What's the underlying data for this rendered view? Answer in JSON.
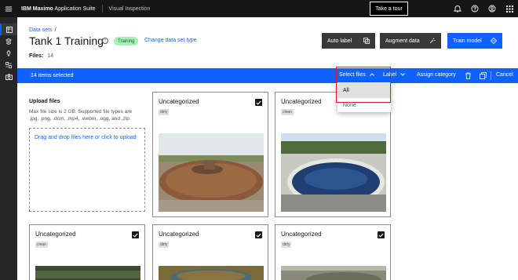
{
  "header": {
    "brand_bold": "IBM Maximo",
    "brand_rest": " Application Suite",
    "product": "Visual Inspection",
    "tour_button": "Take a tour"
  },
  "page": {
    "breadcrumb": "Data sets",
    "breadcrumb_sep": "/",
    "title": "Tank 1 Training",
    "status_tag": "Training",
    "change_link": "Change data set type",
    "files_label": "Files:",
    "files_count": "14",
    "auto_label_button": "Auto label",
    "augment_button": "Augment data",
    "train_button": "Train model"
  },
  "selection_bar": {
    "count_text": "14 items selected",
    "select_files": "Select files",
    "label": "Label",
    "assign_category": "Assign category",
    "cancel": "Cancel"
  },
  "dropdown": {
    "options": [
      "All",
      "None"
    ],
    "selected": "All"
  },
  "upload": {
    "title": "Upload files",
    "description": "Max file size is 2 GB. Supported file types are .jpg, .png, .dcm, .mp4, .webm, .ogg, and .zip.",
    "dropzone_text": "Drag and drop files here or click to upload"
  },
  "cards": [
    {
      "category": "Uncategorized",
      "tag": "dirty",
      "checked": true
    },
    {
      "category": "Uncategorized",
      "tag": "clean",
      "checked": true
    },
    {
      "category": "Uncategorized",
      "tag": "clean",
      "checked": true
    },
    {
      "category": "Uncategorized",
      "tag": "dirty",
      "checked": true
    },
    {
      "category": "Uncategorized",
      "tag": "dirty",
      "checked": true
    }
  ],
  "colors": {
    "accent": "#0f62fe",
    "header_bg": "#161616",
    "nav_bg": "#262626",
    "training_tag_bg": "#a7f0ba",
    "highlight_red": "#da1e28"
  }
}
